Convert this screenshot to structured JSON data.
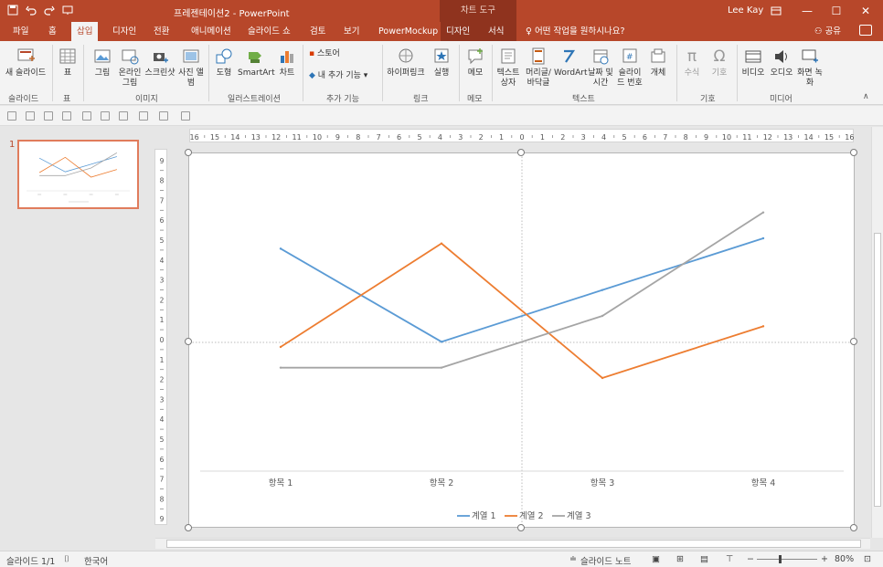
{
  "window": {
    "title": "프레젠테이션2 - PowerPoint",
    "context_tab_group": "차트 도구",
    "user": "Lee Kay"
  },
  "tabs": [
    "파일",
    "홈",
    "삽입",
    "디자인",
    "전환",
    "애니메이션",
    "슬라이드 쇼",
    "검토",
    "보기",
    "PowerMockup",
    "디자인",
    "서식"
  ],
  "active_tab": "삽입",
  "tell_me": "어떤 작업을 원하시나요?",
  "share": "공유",
  "ribbon": {
    "new_slide": "새 슬라이드",
    "table": "표",
    "picture": "그림",
    "online_picture": "온라인 그림",
    "screenshot": "스크린샷",
    "photo_album": "사진 앨범",
    "shapes": "도형",
    "smartart": "SmartArt",
    "chart": "차트",
    "store": "스토어",
    "my_addins": "내 추가 기능",
    "hyperlink": "하이퍼링크",
    "action": "실행",
    "comment": "메모",
    "text_box": "텍스트 상자",
    "header_footer": "머리글/ 바닥글",
    "wordart": "WordArt",
    "date_time": "날짜 및 시간",
    "slide_number": "슬라이드 번호",
    "object": "개체",
    "equation": "수식",
    "symbol": "기호",
    "video": "비디오",
    "audio": "오디오",
    "screen_recording": "화면 녹화",
    "groups": [
      "슬라이드",
      "표",
      "이미지",
      "일러스트레이션",
      "추가 기능",
      "링크",
      "메모",
      "텍스트",
      "기호",
      "미디어"
    ]
  },
  "thumbnail": {
    "number": "1"
  },
  "status": {
    "slide": "슬라이드 1/1",
    "language": "한국어",
    "notes": "슬라이드 노트",
    "zoom": "80%"
  },
  "colors": {
    "brand": "#b7472a",
    "series1": "#5b9bd5",
    "series2": "#ed7d31",
    "series3": "#a5a5a5"
  },
  "chart_data": {
    "type": "line",
    "categories": [
      "항목 1",
      "항목 2",
      "항목 3",
      "항목 4"
    ],
    "series": [
      {
        "name": "계열 1",
        "values": [
          4.3,
          2.5,
          3.5,
          4.5
        ]
      },
      {
        "name": "계열 2",
        "values": [
          2.4,
          4.4,
          1.8,
          2.8
        ]
      },
      {
        "name": "계열 3",
        "values": [
          2.0,
          2.0,
          3.0,
          5.0
        ]
      }
    ],
    "legend": "bottom",
    "grid": false
  }
}
